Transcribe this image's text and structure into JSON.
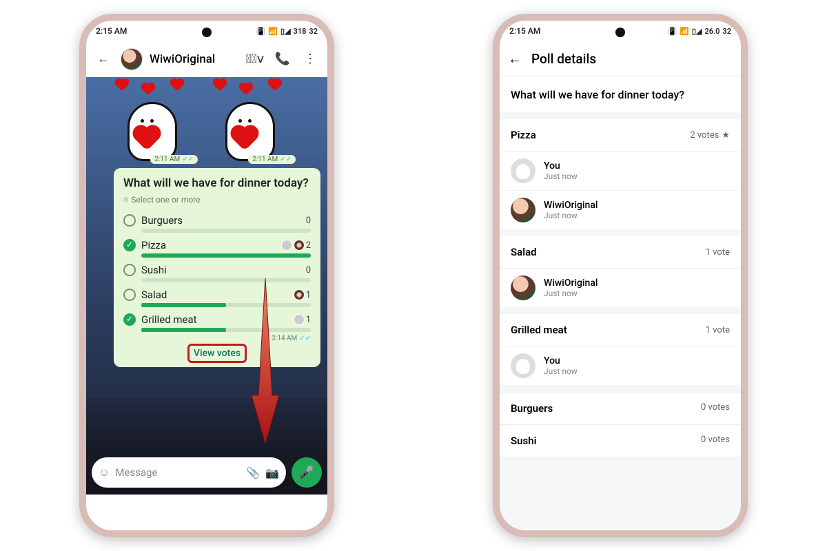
{
  "status": {
    "time": "2:15 AM",
    "net": "318",
    "bat": "32"
  },
  "status2": {
    "time": "2:15 AM",
    "net": "26.0",
    "bat": "32"
  },
  "left": {
    "contact": "WiwiOriginal",
    "sticker_time": "2:11 AM",
    "poll": {
      "question": "What will we have for dinner today?",
      "hint": "Select one or more",
      "time": "2:14 AM",
      "view_votes": "View votes",
      "options": [
        {
          "label": "Burguers",
          "count": "0",
          "checked": false,
          "fill": 0
        },
        {
          "label": "Pizza",
          "count": "2",
          "checked": true,
          "fill": 1
        },
        {
          "label": "Sushi",
          "count": "0",
          "checked": false,
          "fill": 0
        },
        {
          "label": "Salad",
          "count": "1",
          "checked": false,
          "fill": 0.5
        },
        {
          "label": "Grilled meat",
          "count": "1",
          "checked": true,
          "fill": 0.5
        }
      ]
    },
    "input_placeholder": "Message"
  },
  "right": {
    "title": "Poll details",
    "question": "What will we have for dinner today?",
    "sections": [
      {
        "name": "Pizza",
        "votes": "2 votes",
        "star": true,
        "voters": [
          {
            "name": "You",
            "sub": "Just now",
            "avatar": "plain"
          },
          {
            "name": "WiwiOriginal",
            "sub": "Just now",
            "avatar": "color"
          }
        ]
      },
      {
        "name": "Salad",
        "votes": "1 vote",
        "voters": [
          {
            "name": "WiwiOriginal",
            "sub": "Just now",
            "avatar": "color"
          }
        ]
      },
      {
        "name": "Grilled meat",
        "votes": "1 vote",
        "voters": [
          {
            "name": "You",
            "sub": "Just now",
            "avatar": "plain"
          }
        ]
      }
    ],
    "empty": [
      {
        "name": "Burguers",
        "votes": "0 votes"
      },
      {
        "name": "Sushi",
        "votes": "0 votes"
      }
    ]
  }
}
